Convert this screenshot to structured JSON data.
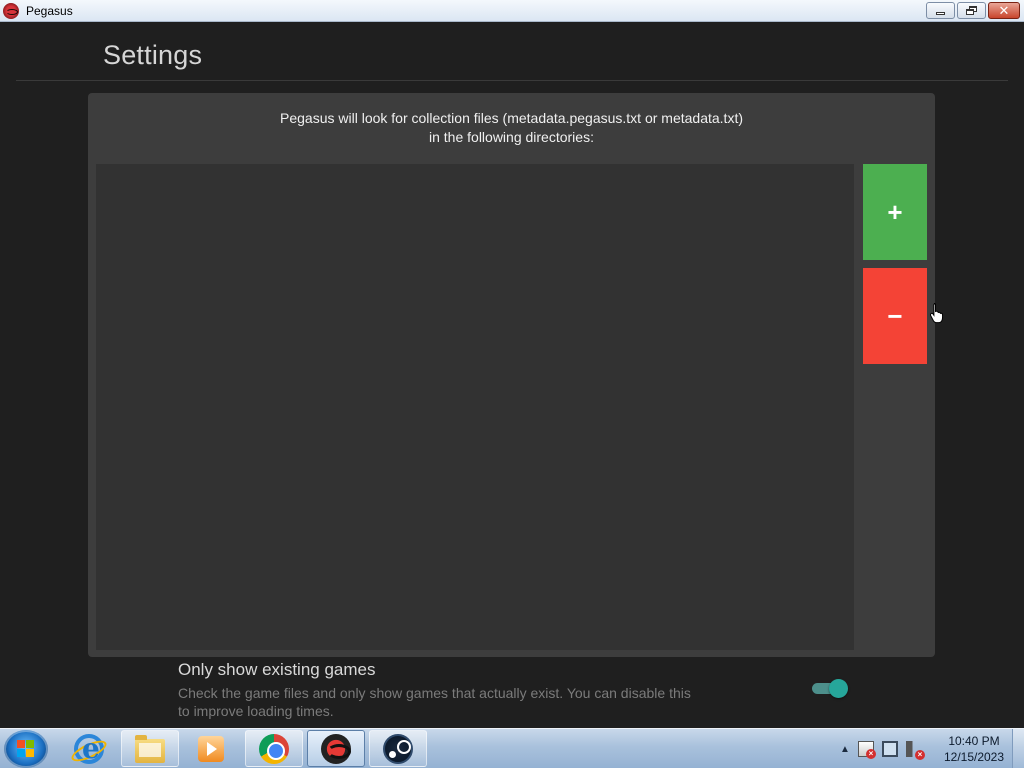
{
  "window": {
    "title": "Pegasus",
    "controls": {
      "minimize": "minimize",
      "maximize": "restore",
      "close": "close",
      "close_glyph": "✕"
    }
  },
  "settings": {
    "page_title": "Settings",
    "directories_panel": {
      "description_line1": "Pegasus will look for collection files (metadata.pegasus.txt or metadata.txt)",
      "description_line2": "in the following directories:",
      "directories": [],
      "add_label": "+",
      "remove_label": "−",
      "add_color": "#4caf50",
      "remove_color": "#f44336"
    },
    "only_existing": {
      "title": "Only show existing games",
      "description": "Check the game files and only show games that actually exist. You can disable this to improve loading times.",
      "enabled": true,
      "toggle_color": "#26a69a"
    }
  },
  "taskbar": {
    "items": [
      {
        "name": "internet-explorer",
        "icon": "ie-icon"
      },
      {
        "name": "windows-explorer",
        "icon": "folder-icon"
      },
      {
        "name": "media-player",
        "icon": "media-icon"
      },
      {
        "name": "chrome",
        "icon": "chrome-icon"
      },
      {
        "name": "pegasus",
        "icon": "pegasus-icon",
        "active": true
      },
      {
        "name": "steam",
        "icon": "steam-icon"
      }
    ],
    "tray": {
      "show_hidden": "▲"
    },
    "clock": {
      "time": "10:40 PM",
      "date": "12/15/2023"
    }
  }
}
